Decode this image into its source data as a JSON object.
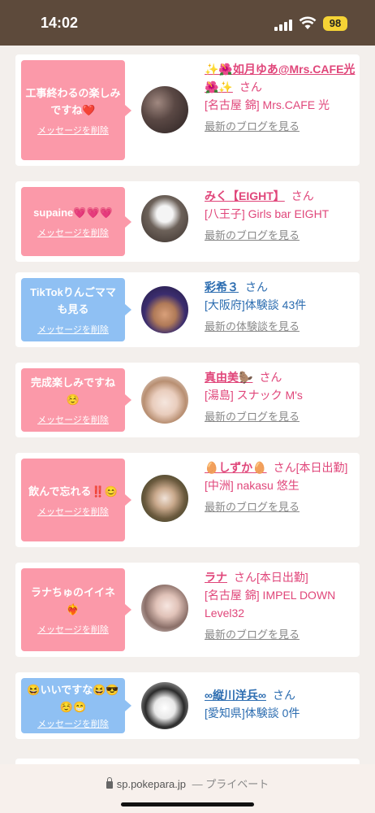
{
  "status_bar": {
    "time": "14:02",
    "battery": "98"
  },
  "delete_label": "メッセージを削除",
  "san": "さん",
  "cards": [
    {
      "message": "工事終わるの楽しみですね❤️",
      "bubble_color": "pink",
      "name": "✨🌺如月ゆあ@Mrs.CAFE光🌺✨",
      "name_color": "pink",
      "status": "",
      "shop": "[名古屋 錦] Mrs.CAFE 光",
      "blog_link": "最新のブログを見る",
      "avatar_color": "#3a2e2e"
    },
    {
      "message": "supaine💗💗💗",
      "bubble_color": "pink",
      "name": "みく【EIGHT】",
      "name_color": "pink",
      "status": "",
      "shop": "[八王子] Girls bar EIGHT",
      "blog_link": "最新のブログを見る",
      "avatar_color": "#4a4440"
    },
    {
      "message": "TikTokりんごママも見る",
      "bubble_color": "blue",
      "name": "彩希３",
      "name_color": "blue",
      "status": "",
      "shop": "[大阪府]体験談 43件",
      "blog_link": "最新の体験談を見る",
      "avatar_color": "#3b2d6e"
    },
    {
      "message": "完成楽しみですね☺️",
      "bubble_color": "pink",
      "name": "真由美🦫",
      "name_color": "pink",
      "status": "",
      "shop": "[湯島] スナック M's",
      "blog_link": "最新のブログを見る",
      "avatar_color": "#d9b9a0"
    },
    {
      "message": "飲んで忘れる‼️😊",
      "bubble_color": "pink",
      "name": "🥚しずか🥚",
      "name_color": "pink",
      "status": "[本日出勤]",
      "shop": "[中洲] nakasu 悠生",
      "blog_link": "最新のブログを見る",
      "avatar_color": "#7a6a52"
    },
    {
      "message": "ラナちゅのイイネ❤️‍🔥",
      "bubble_color": "pink",
      "name": "ラナ",
      "name_color": "pink",
      "status": "[本日出勤]",
      "shop": "[名古屋 錦] IMPEL DOWN Level32",
      "blog_link": "最新のブログを見る",
      "avatar_color": "#e8d8d8"
    },
    {
      "message": "😆いいですな😆😎☺️😁",
      "bubble_color": "blue",
      "name": "∞縦川洋兵∞",
      "name_color": "blue",
      "status": "",
      "shop": "[愛知県]体験談 0件",
      "blog_link": "",
      "avatar_color": "#f4f4f4"
    }
  ],
  "browser": {
    "url": "sp.pokepara.jp",
    "suffix": "— プライベート"
  }
}
